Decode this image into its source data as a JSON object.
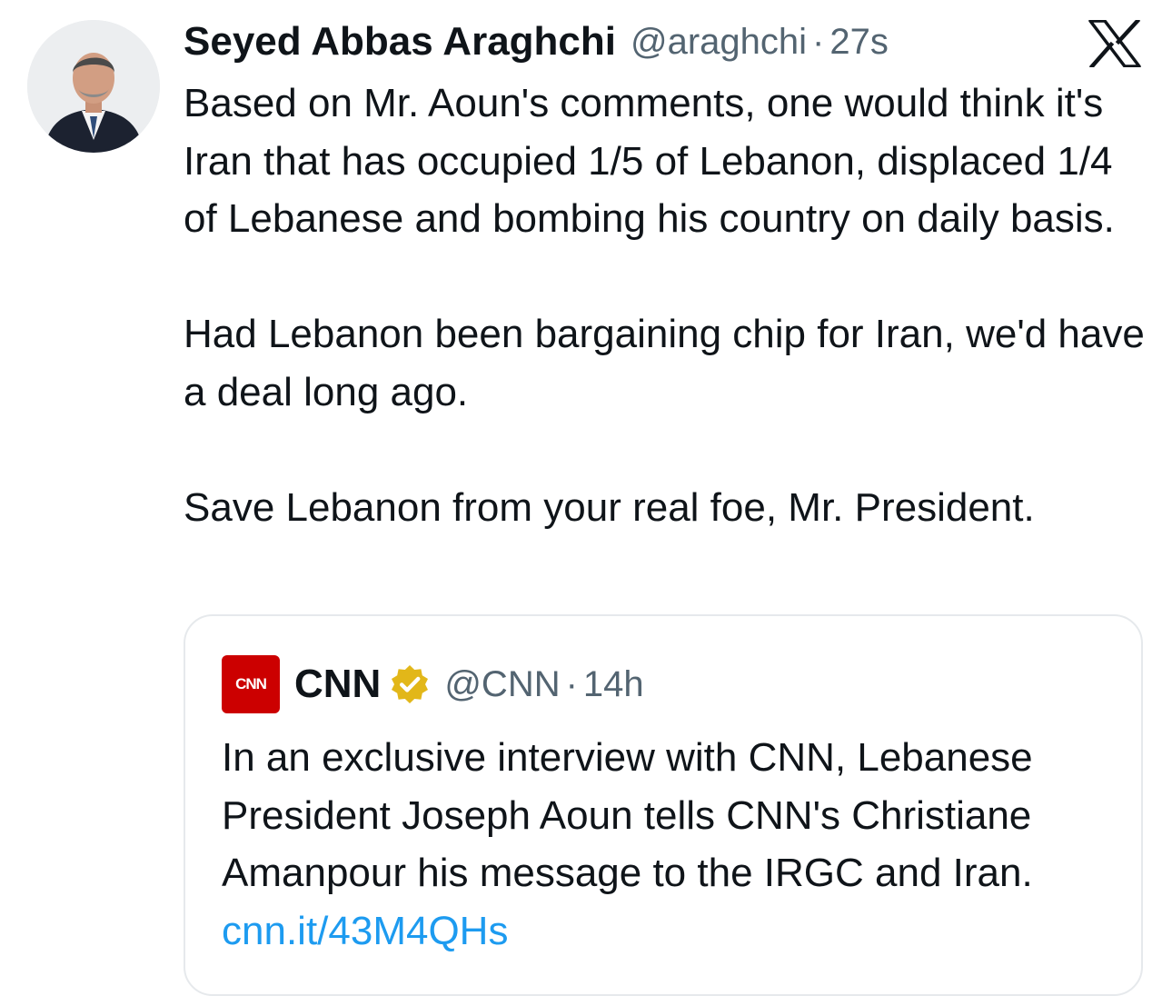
{
  "tweet": {
    "author_name": "Seyed Abbas Araghchi",
    "handle": "@araghchi",
    "separator": "·",
    "time": "27s",
    "paragraphs": [
      "Based on Mr. Aoun's comments, one would think it's Iran that has occupied 1/5 of Lebanon, displaced 1/4 of Lebanese and bombing his country on daily basis.",
      "Had Lebanon been bargaining chip for Iran, we'd have a deal long ago.",
      "Save Lebanon from your real foe, Mr. President."
    ]
  },
  "quoted_tweet": {
    "logo_text": "CNN",
    "author_name": "CNN",
    "verified": true,
    "handle": "@CNN",
    "separator": "·",
    "time": "14h",
    "text": "In an exclusive interview with CNN, Lebanese President Joseph Aoun tells CNN's Christiane Amanpour his message to the IRGC and Iran.",
    "link": "cnn.it/43M4QHs"
  },
  "colors": {
    "text": "#0f1419",
    "secondary": "#536471",
    "link": "#1d9bf0",
    "border": "#e6e9ec",
    "cnn_red": "#cc0000",
    "verified_gold": "#e2b719"
  },
  "icons": [
    "avatar-photo",
    "x-logo-icon",
    "cnn-logo",
    "verified-badge-icon"
  ]
}
